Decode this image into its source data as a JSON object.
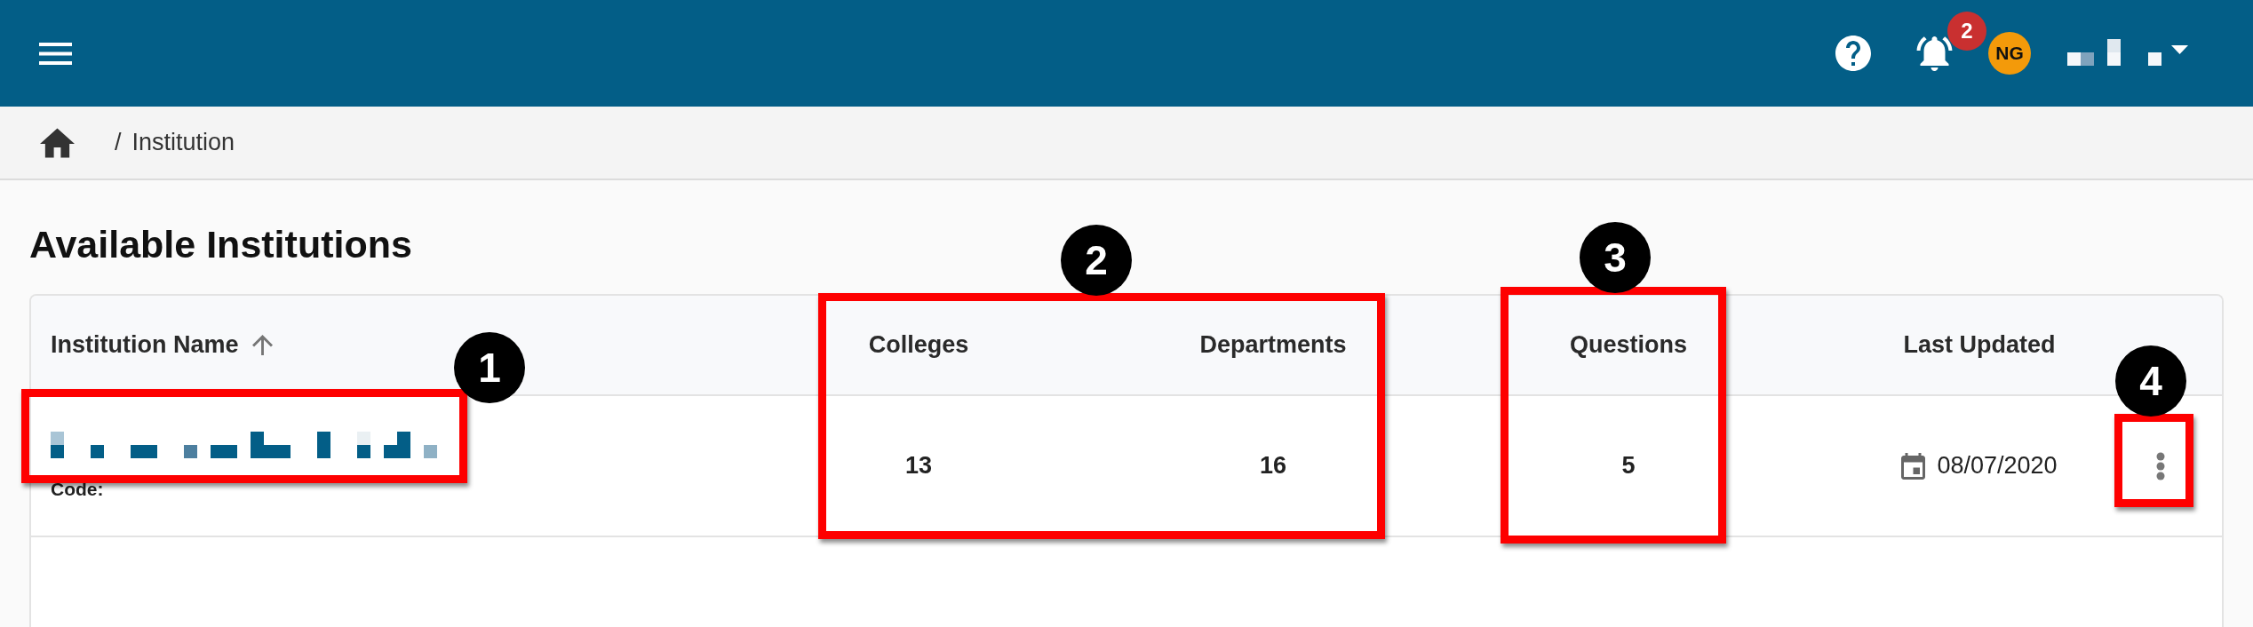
{
  "app_bar": {
    "notification_count": "2",
    "avatar_initials": "NG"
  },
  "breadcrumb": {
    "separator": "/",
    "current": "Institution"
  },
  "page_title": "Available Institutions",
  "table": {
    "columns": [
      {
        "label": "Institution Name",
        "sorted": true,
        "ascending": true
      },
      {
        "label": "Colleges",
        "sorted": false
      },
      {
        "label": "Departments",
        "sorted": false
      },
      {
        "label": "Questions",
        "sorted": false
      },
      {
        "label": "Last Updated",
        "sorted": false
      }
    ],
    "rows": [
      {
        "code_label": "Code:",
        "colleges": "13",
        "departments": "16",
        "questions": "5",
        "last_updated": "08/07/2020"
      }
    ]
  },
  "annotations": [
    {
      "number": "1"
    },
    {
      "number": "2"
    },
    {
      "number": "3"
    },
    {
      "number": "4"
    }
  ]
}
